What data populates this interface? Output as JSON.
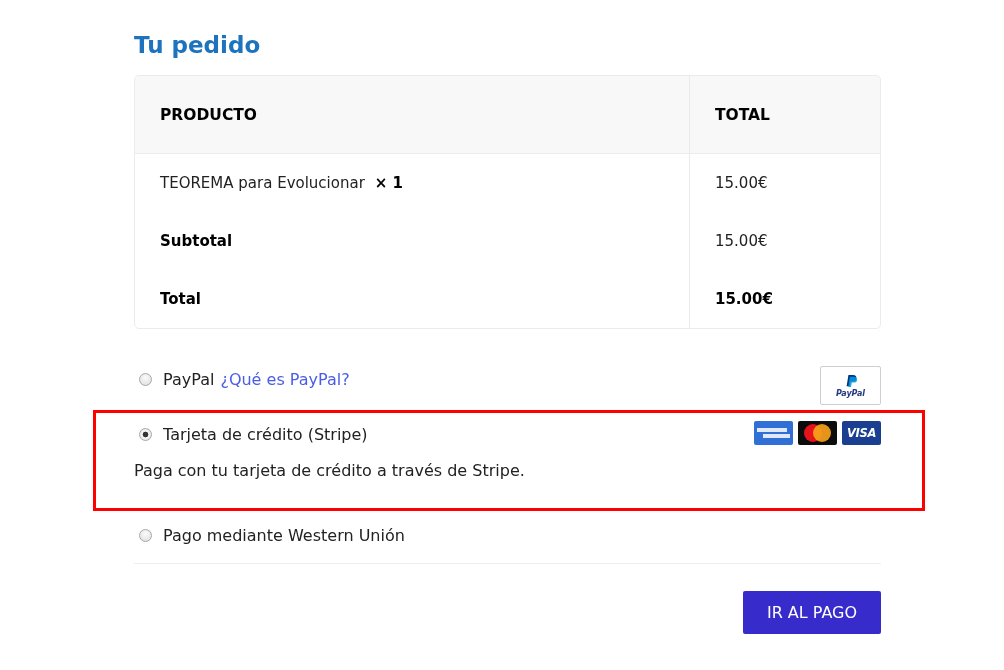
{
  "heading": "Tu pedido",
  "order_table": {
    "columns": [
      "PRODUCTO",
      "TOTAL"
    ],
    "rows": [
      {
        "kind": "item",
        "label": "TEOREMA para Evolucionar",
        "quantity": "× 1",
        "total": "15.00€"
      },
      {
        "kind": "subtotal",
        "label": "Subtotal",
        "total": "15.00€"
      },
      {
        "kind": "total",
        "label": "Total",
        "total": "15.00€"
      }
    ]
  },
  "payment_methods": [
    {
      "label": "PayPal",
      "link": "¿Qué es PayPal?",
      "selected": false,
      "highlighted": false,
      "logos": [
        {
          "kind": "paypal",
          "text": "PayPal"
        }
      ]
    },
    {
      "label": "Tarjeta de crédito (Stripe)",
      "selected": true,
      "highlighted": true,
      "description": "Paga con tu tarjeta de crédito a través de Stripe.",
      "logos": [
        {
          "kind": "amex"
        },
        {
          "kind": "mastercard"
        },
        {
          "kind": "visa",
          "text": "VISA"
        }
      ]
    },
    {
      "label": "Pago mediante Western Unión",
      "selected": false,
      "highlighted": false
    }
  ],
  "submit_button": "IR AL PAGO"
}
